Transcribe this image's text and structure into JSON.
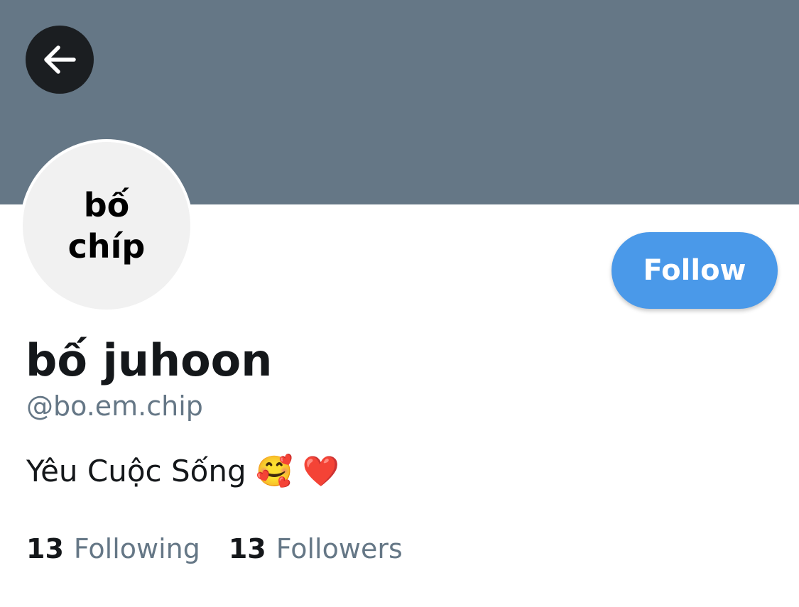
{
  "header": {
    "back_icon": "arrow-left-icon",
    "banner_color": "#657786"
  },
  "profile": {
    "avatar_text_line1": "bố",
    "avatar_text_line2": "chíp",
    "display_name": "bố juhoon",
    "handle": "@bo.em.chip",
    "bio": "Yêu Cuộc Sống 🥰 ❤️"
  },
  "actions": {
    "follow_label": "Follow",
    "accent_color": "#4a99e9"
  },
  "stats": {
    "following_count": "13",
    "following_label": "Following",
    "followers_count": "13",
    "followers_label": "Followers"
  }
}
